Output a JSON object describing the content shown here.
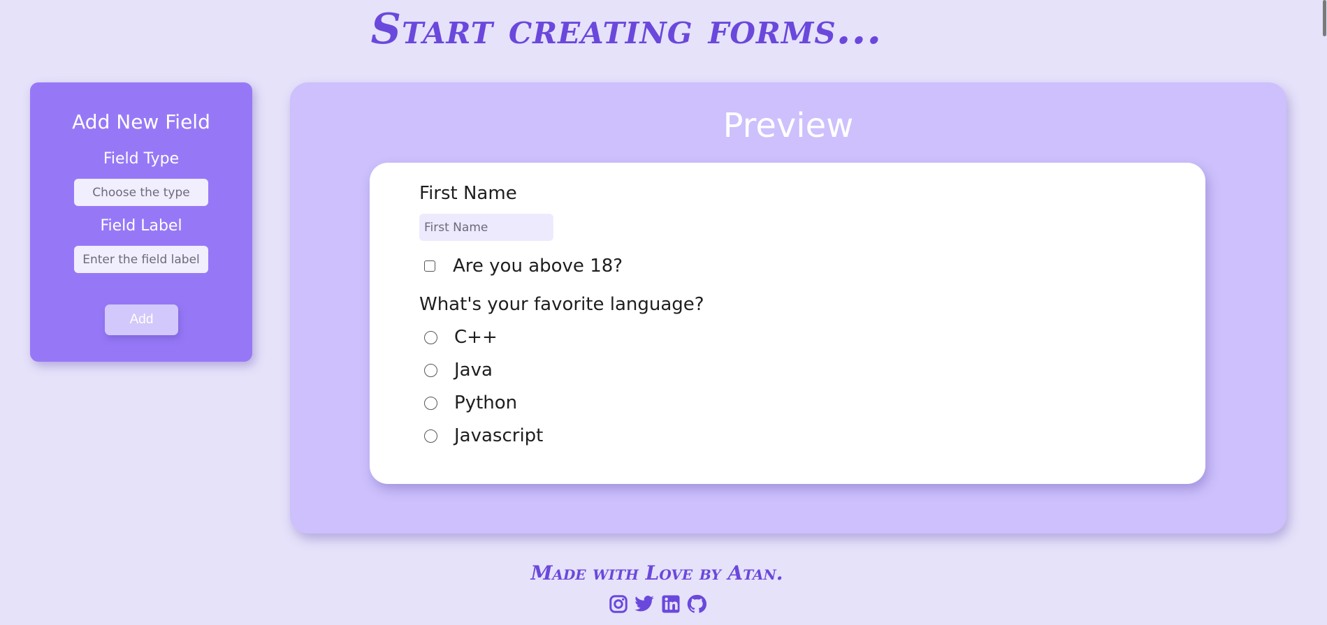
{
  "header": {
    "title": "Start creating forms..."
  },
  "builder": {
    "heading": "Add New Field",
    "field_type_label": "Field Type",
    "field_type_placeholder": "Choose the type",
    "field_label_label": "Field Label",
    "field_label_placeholder": "Enter the field label",
    "add_label": "Add"
  },
  "preview": {
    "heading": "Preview",
    "first_name_label": "First Name",
    "first_name_placeholder": "First Name",
    "checkbox_label": "Are you above 18?",
    "checkbox_checked": false,
    "radio_question": "What's your favorite language?",
    "options": [
      "C++",
      "Java",
      "Python",
      "Javascript"
    ]
  },
  "footer": {
    "text": "Made with Love by Atan.",
    "icons": [
      "instagram-icon",
      "twitter-icon",
      "linkedin-icon",
      "github-icon"
    ]
  },
  "colors": {
    "background": "#e6e2fa",
    "accent": "#6a48dc",
    "panel": "#9678f7",
    "preview_bg": "#cdc0fc"
  }
}
